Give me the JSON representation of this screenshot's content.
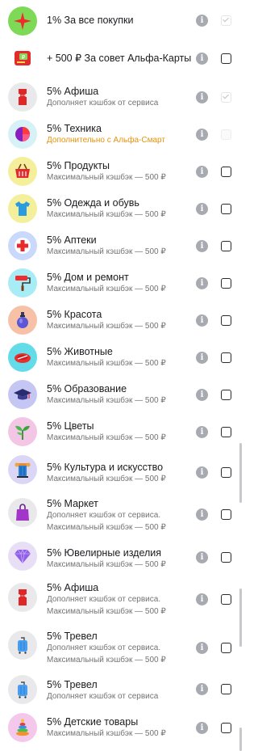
{
  "info_glyph": "i",
  "items": [
    {
      "title": "1% За все покупки",
      "subtitle": "",
      "state": "checked",
      "bg": "#7ed957",
      "icon": "star-icon"
    },
    {
      "title": "+ 500 ₽ За совет Альфа-Карты",
      "subtitle": "",
      "state": "unchecked",
      "bg": "#ffffff",
      "icon": "alfa-card-icon"
    },
    {
      "title": "5% Афиша",
      "subtitle": "Дополняет кэшбэк от сервиса",
      "subtitle2": "",
      "state": "checked",
      "bg": "#e9e9ec",
      "icon": "ticket-icon"
    },
    {
      "title": "5% Техника",
      "subtitle": "Дополнительно с Альфа-Смарт",
      "subtitle2": "",
      "state": "disabled",
      "bg": "#d6f2f6",
      "icon": "pie-device-icon",
      "subtitle_color": "#e8920c"
    },
    {
      "title": "5% Продукты",
      "subtitle": "Максимальный кэшбэк — 500 ₽",
      "subtitle2": "",
      "state": "unchecked",
      "bg": "#f5ef9c",
      "icon": "basket-icon"
    },
    {
      "title": "5% Одежда и обувь",
      "subtitle": "Максимальный кэшбэк — 500 ₽",
      "subtitle2": "",
      "state": "unchecked",
      "bg": "#f3ef9a",
      "icon": "tshirt-icon"
    },
    {
      "title": "5% Аптеки",
      "subtitle": "Максимальный кэшбэк — 500 ₽",
      "subtitle2": "",
      "state": "unchecked",
      "bg": "#c9d9fb",
      "icon": "pharmacy-cross-icon"
    },
    {
      "title": "5% Дом и ремонт",
      "subtitle": "Максимальный кэшбэк — 500 ₽",
      "subtitle2": "",
      "state": "unchecked",
      "bg": "#a8ecf6",
      "icon": "paint-roller-icon"
    },
    {
      "title": "5% Красота",
      "subtitle": "Максимальный кэшбэк — 500 ₽",
      "subtitle2": "",
      "state": "unchecked",
      "bg": "#f7c1a8",
      "icon": "perfume-icon"
    },
    {
      "title": "5% Животные",
      "subtitle": "Максимальный кэшбэк — 500 ₽",
      "subtitle2": "",
      "state": "unchecked",
      "bg": "#63dbe8",
      "icon": "pet-bed-icon"
    },
    {
      "title": "5% Образование",
      "subtitle": "Максимальный кэшбэк — 500 ₽",
      "subtitle2": "",
      "state": "unchecked",
      "bg": "#c6c6f5",
      "icon": "graduation-cap-icon"
    },
    {
      "title": "5% Цветы",
      "subtitle": "Максимальный кэшбэк — 500 ₽",
      "subtitle2": "",
      "state": "unchecked",
      "bg": "#f3c6e6",
      "icon": "sprout-icon"
    },
    {
      "title": "5% Культура и искусство",
      "subtitle": "Максимальный кэшбэк — 500 ₽",
      "subtitle2": "",
      "state": "unchecked",
      "bg": "#dcd6f6",
      "icon": "column-icon"
    },
    {
      "title": "5% Маркет",
      "subtitle": "Дополняет кэшбэк от сервиса.",
      "subtitle2": "Максимальный кэшбэк — 500 ₽",
      "state": "unchecked",
      "bg": "#e9e9ec",
      "icon": "shopping-bag-icon"
    },
    {
      "title": "5% Ювелирные изделия",
      "subtitle": "Максимальный кэшбэк — 500 ₽",
      "subtitle2": "",
      "state": "unchecked",
      "bg": "#e8def6",
      "icon": "diamond-icon"
    },
    {
      "title": "5% Афиша",
      "subtitle": "Дополняет кэшбэк от сервиса.",
      "subtitle2": "Максимальный кэшбэк — 500 ₽",
      "state": "unchecked",
      "bg": "#e9e9ec",
      "icon": "ticket-icon"
    },
    {
      "title": "5% Тревел",
      "subtitle": "Дополняет кэшбэк от сервиса.",
      "subtitle2": "Максимальный кэшбэк — 500 ₽",
      "state": "unchecked",
      "bg": "#e9e9ec",
      "icon": "suitcase-icon"
    },
    {
      "title": "5% Тревел",
      "subtitle": "Дополняет кэшбэк от сервиса",
      "subtitle2": "",
      "state": "unchecked",
      "bg": "#e9e9ec",
      "icon": "suitcase-icon"
    },
    {
      "title": "5% Детские товары",
      "subtitle": "Максимальный кэшбэк — 500 ₽",
      "subtitle2": "",
      "state": "unchecked",
      "bg": "#f3c8ea",
      "icon": "toy-pyramid-icon"
    }
  ]
}
